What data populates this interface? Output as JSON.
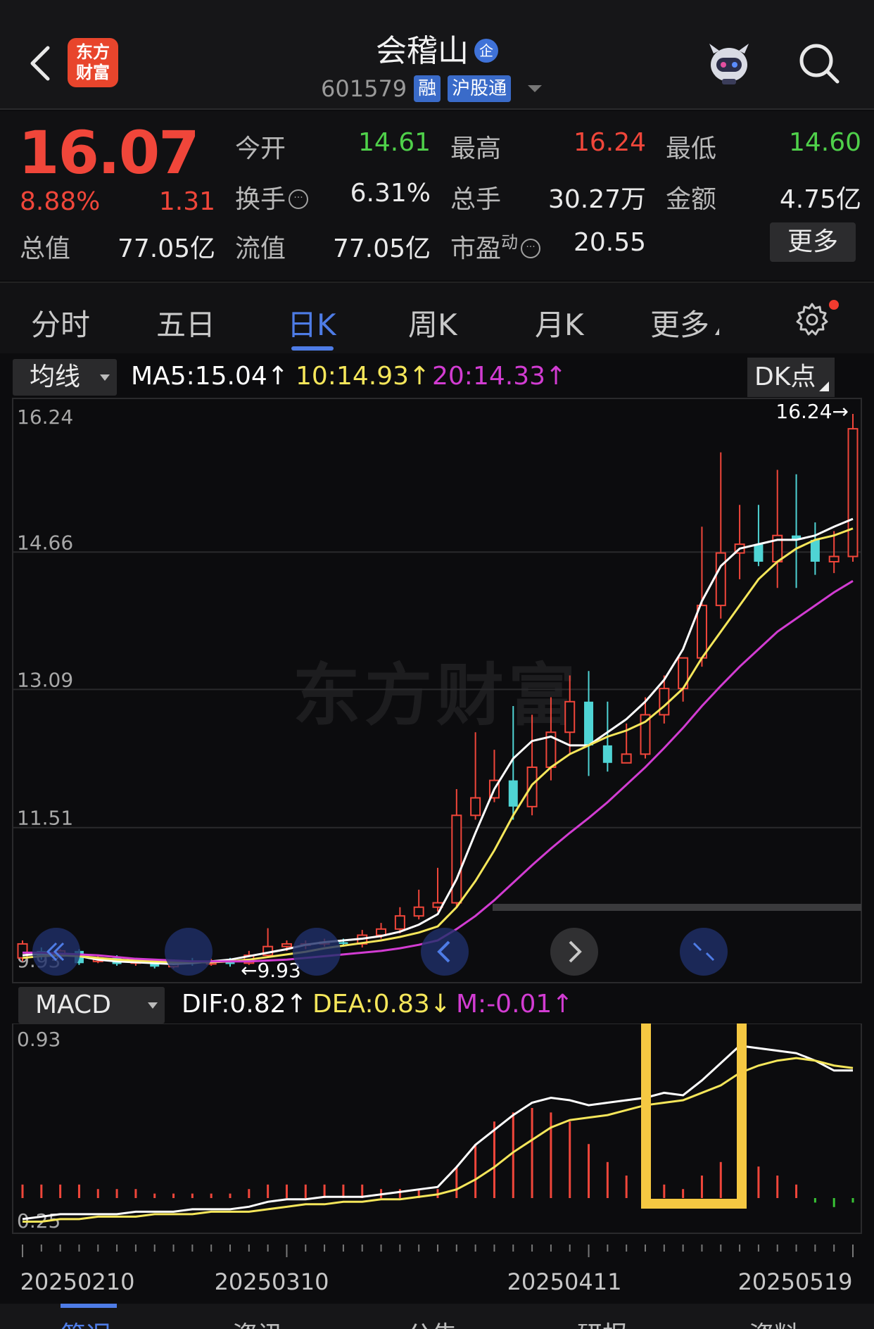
{
  "header": {
    "logo_line1": "东方",
    "logo_line2": "财富",
    "stock_name": "会稽山",
    "qi_badge": "企",
    "stock_code": "601579",
    "tag_rong": "融",
    "tag_hgt": "沪股通"
  },
  "quote": {
    "price": "16.07",
    "change_pct": "8.88%",
    "change_amt": "1.31",
    "open_label": "今开",
    "open": "14.61",
    "high_label": "最高",
    "high": "16.24",
    "low_label": "最低",
    "low": "14.60",
    "turnover_label": "换手",
    "turnover": "6.31%",
    "volume_label": "总手",
    "volume": "30.27万",
    "amount_label": "金额",
    "amount": "4.75亿",
    "mktcap_label": "总值",
    "mktcap": "77.05亿",
    "float_label": "流值",
    "float_cap": "77.05亿",
    "pe_label": "市盈",
    "pe_sup": "动",
    "pe": "20.55",
    "more_label": "更多"
  },
  "tabs": [
    "分时",
    "五日",
    "日K",
    "周K",
    "月K",
    "更多"
  ],
  "active_tab": "日K",
  "ma": {
    "selector": "均线",
    "ma5": "MA5:15.04↑",
    "ma10": "10:14.93↑",
    "ma20": "20:14.33↑",
    "dk_label": "DK点"
  },
  "macd_bar": {
    "selector": "MACD",
    "dif": "DIF:0.82↑",
    "dea": "DEA:0.83↓",
    "m": "M:-0.01↑"
  },
  "colors": {
    "up": "#f0463a",
    "down": "#4fd4d4",
    "ma5": "#ffffff",
    "ma10": "#f5e65a",
    "ma20": "#d23cd2",
    "accent": "#4e7ce6",
    "highlight_box": "#f5c842"
  },
  "chart_data": [
    {
      "type": "candlestick",
      "title": "",
      "y_ticks": [
        "16.24",
        "14.66",
        "13.09",
        "11.51",
        "9.93"
      ],
      "ylim": [
        9.93,
        16.24
      ],
      "max_label": "16.24→",
      "min_label": "←9.93",
      "series": [
        {
          "name": "MA5",
          "values": [
            10.05,
            10.07,
            10.06,
            10.04,
            10.0,
            9.98,
            9.97,
            9.96,
            9.95,
            9.96,
            9.98,
            10.0,
            10.04,
            10.08,
            10.12,
            10.17,
            10.2,
            10.22,
            10.24,
            10.27,
            10.32,
            10.4,
            10.52,
            10.92,
            11.45,
            11.95,
            12.3,
            12.5,
            12.55,
            12.45,
            12.45,
            12.6,
            12.75,
            12.95,
            13.2,
            13.55,
            14.1,
            14.5,
            14.7,
            14.75,
            14.8,
            14.8,
            14.85,
            14.95,
            15.04
          ]
        },
        {
          "name": "10",
          "values": [
            10.02,
            10.04,
            10.05,
            10.04,
            10.02,
            10.0,
            9.99,
            9.98,
            9.97,
            9.97,
            9.97,
            9.98,
            10.0,
            10.03,
            10.06,
            10.09,
            10.13,
            10.16,
            10.19,
            10.22,
            10.26,
            10.31,
            10.38,
            10.6,
            10.9,
            11.25,
            11.65,
            12.0,
            12.2,
            12.35,
            12.45,
            12.55,
            12.62,
            12.72,
            12.9,
            13.1,
            13.45,
            13.75,
            14.05,
            14.35,
            14.55,
            14.7,
            14.8,
            14.85,
            14.93
          ]
        },
        {
          "name": "20",
          "values": [
            10.08,
            10.08,
            10.07,
            10.06,
            10.05,
            10.03,
            10.01,
            10.0,
            9.99,
            9.98,
            9.98,
            9.98,
            9.98,
            9.99,
            10.0,
            10.02,
            10.04,
            10.06,
            10.08,
            10.1,
            10.13,
            10.17,
            10.22,
            10.35,
            10.5,
            10.68,
            10.88,
            11.08,
            11.27,
            11.45,
            11.62,
            11.8,
            12.0,
            12.2,
            12.42,
            12.65,
            12.9,
            13.13,
            13.35,
            13.55,
            13.75,
            13.9,
            14.05,
            14.2,
            14.33
          ]
        }
      ],
      "candles": {
        "open": [
          10.02,
          10.1,
          10.04,
          10.1,
          9.98,
          10.02,
          9.96,
          9.97,
          9.92,
          9.98,
          9.95,
          9.98,
          9.96,
          10.05,
          10.15,
          10.18,
          10.18,
          10.2,
          10.18,
          10.28,
          10.35,
          10.5,
          10.6,
          10.65,
          11.65,
          11.85,
          12.05,
          11.75,
          12.2,
          12.6,
          12.95,
          12.45,
          12.25,
          12.35,
          12.8,
          13.1,
          13.45,
          14.05,
          14.65,
          14.75,
          14.55,
          14.85,
          14.8,
          14.55,
          14.61
        ],
        "close": [
          10.18,
          10.04,
          10.1,
          9.96,
          10.02,
          9.95,
          9.98,
          9.92,
          9.96,
          9.96,
          9.98,
          9.95,
          10.05,
          10.15,
          10.18,
          10.18,
          10.2,
          10.18,
          10.28,
          10.35,
          10.5,
          10.6,
          10.65,
          11.65,
          11.85,
          12.05,
          11.75,
          12.2,
          12.6,
          12.95,
          12.45,
          12.25,
          12.35,
          12.8,
          13.1,
          13.45,
          14.05,
          14.65,
          14.75,
          14.55,
          14.85,
          14.8,
          14.55,
          14.61,
          16.07
        ],
        "high": [
          10.22,
          10.14,
          10.12,
          10.12,
          10.04,
          10.05,
          10.02,
          10.0,
          9.99,
          10.02,
          10.01,
          10.02,
          10.1,
          10.36,
          10.22,
          10.22,
          10.24,
          10.24,
          10.34,
          10.42,
          10.6,
          10.8,
          11.05,
          11.95,
          12.6,
          12.4,
          12.9,
          12.8,
          13.0,
          13.25,
          13.3,
          12.95,
          12.7,
          13.0,
          13.25,
          13.45,
          14.95,
          15.8,
          15.2,
          15.2,
          15.6,
          15.55,
          15.0,
          14.9,
          16.24
        ],
        "low": [
          9.98,
          10.0,
          10.0,
          9.94,
          9.96,
          9.93,
          9.93,
          9.9,
          9.9,
          9.93,
          9.93,
          9.92,
          9.94,
          10.02,
          10.1,
          10.12,
          10.15,
          10.15,
          10.14,
          10.24,
          10.3,
          10.46,
          10.55,
          10.6,
          11.6,
          11.8,
          11.6,
          11.65,
          12.05,
          12.35,
          12.1,
          12.15,
          12.25,
          12.3,
          12.7,
          12.95,
          13.35,
          13.9,
          14.35,
          14.5,
          14.25,
          14.25,
          14.4,
          14.42,
          14.55
        ]
      }
    },
    {
      "type": "macd",
      "y_ticks": [
        "0.93",
        "0.25"
      ],
      "ylim": [
        0.18,
        0.97
      ],
      "series": [
        {
          "name": "DIF",
          "values": [
            0.22,
            0.23,
            0.24,
            0.24,
            0.24,
            0.24,
            0.25,
            0.25,
            0.25,
            0.26,
            0.26,
            0.26,
            0.27,
            0.29,
            0.3,
            0.3,
            0.31,
            0.31,
            0.31,
            0.32,
            0.33,
            0.34,
            0.35,
            0.43,
            0.52,
            0.58,
            0.64,
            0.69,
            0.71,
            0.7,
            0.68,
            0.69,
            0.7,
            0.71,
            0.73,
            0.72,
            0.78,
            0.85,
            0.92,
            0.91,
            0.9,
            0.89,
            0.86,
            0.82,
            0.82
          ]
        },
        {
          "name": "DEA",
          "values": [
            0.21,
            0.21,
            0.22,
            0.22,
            0.23,
            0.23,
            0.23,
            0.24,
            0.24,
            0.24,
            0.25,
            0.25,
            0.25,
            0.26,
            0.27,
            0.28,
            0.28,
            0.29,
            0.29,
            0.3,
            0.3,
            0.31,
            0.32,
            0.34,
            0.38,
            0.43,
            0.49,
            0.54,
            0.59,
            0.62,
            0.63,
            0.64,
            0.66,
            0.68,
            0.69,
            0.7,
            0.73,
            0.76,
            0.81,
            0.84,
            0.86,
            0.87,
            0.86,
            0.84,
            0.83
          ]
        },
        {
          "name": "M",
          "values": [
            0.03,
            0.03,
            0.03,
            0.03,
            0.02,
            0.02,
            0.02,
            0.01,
            0.01,
            0.01,
            0.01,
            0.01,
            0.02,
            0.03,
            0.03,
            0.03,
            0.03,
            0.03,
            0.03,
            0.02,
            0.02,
            0.02,
            0.02,
            0.07,
            0.12,
            0.17,
            0.19,
            0.2,
            0.19,
            0.17,
            0.12,
            0.08,
            0.05,
            0.04,
            0.03,
            0.02,
            0.05,
            0.08,
            0.1,
            0.07,
            0.05,
            0.03,
            -0.01,
            -0.02,
            -0.01
          ]
        }
      ]
    }
  ],
  "dates": [
    "20250210",
    "20250310",
    "20250411",
    "20250519"
  ],
  "bottom_tabs": [
    "简况",
    "资讯",
    "公告",
    "研报",
    "资料"
  ]
}
